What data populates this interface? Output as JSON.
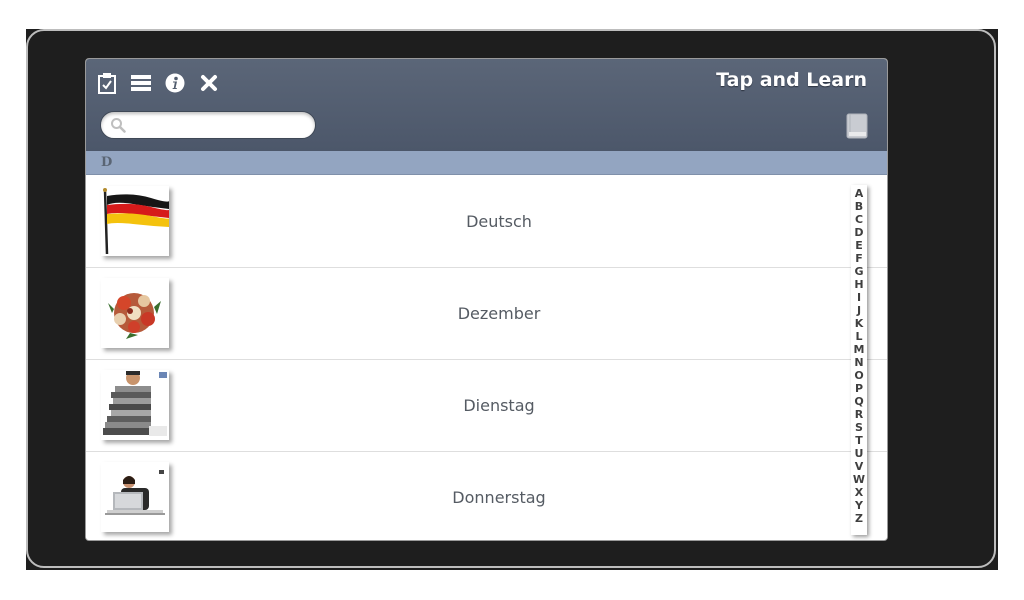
{
  "app": {
    "title": "Tap and Learn"
  },
  "toolbar": {
    "icons": [
      "clipboard-check-icon",
      "menu-list-icon",
      "info-icon",
      "close-icon"
    ]
  },
  "search": {
    "value": "",
    "placeholder": ""
  },
  "section": {
    "header": "D"
  },
  "list": {
    "items": [
      {
        "label": "Deutsch",
        "image": "german-flag"
      },
      {
        "label": "Dezember",
        "image": "christmas-wreath"
      },
      {
        "label": "Dienstag",
        "image": "man-with-binders"
      },
      {
        "label": "Donnerstag",
        "image": "woman-at-laptop"
      }
    ]
  },
  "alphabet": [
    "A",
    "B",
    "C",
    "D",
    "E",
    "F",
    "G",
    "H",
    "I",
    "J",
    "K",
    "L",
    "M",
    "N",
    "O",
    "P",
    "Q",
    "R",
    "S",
    "T",
    "U",
    "V",
    "W",
    "X",
    "Y",
    "Z"
  ],
  "colors": {
    "header": "#525d6e",
    "section_divider": "#93a5c1",
    "device": "#1e1e1e"
  }
}
